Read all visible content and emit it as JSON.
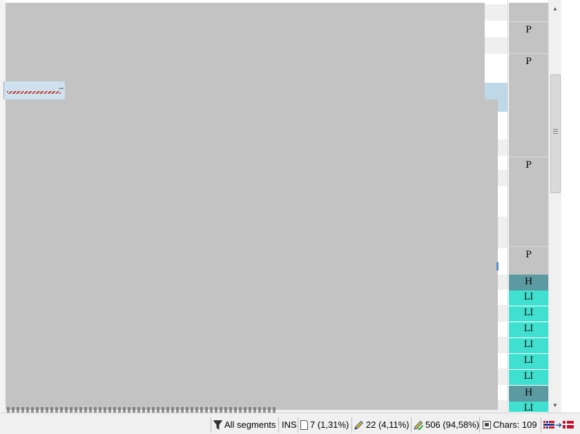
{
  "editor": {
    "style_tags": [
      "P",
      "P",
      "P",
      "P",
      "H",
      "LI",
      "LI",
      "LI",
      "LI",
      "LI",
      "LI",
      "H",
      "LI"
    ],
    "colors": {
      "tag_paragraph": "#c3c3c3",
      "tag_heading": "#5b9aa0",
      "tag_list_item": "#40e0d0",
      "selected_row": "#bfd8e8",
      "redacted": "#c3c3c3"
    }
  },
  "statusbar": {
    "filter_label": "All segments",
    "insert_mode": "INS",
    "untranslated": "7 (1,31%)",
    "draft": "22 (4,11%)",
    "translated": "506 (94,58%)",
    "chars": "Chars: 109",
    "icons": {
      "filter": "funnel-icon",
      "untranslated": "document-icon",
      "draft": "pencil-icon",
      "translated": "pencil-check-icon",
      "chars": "character-count-icon",
      "language_pair": "norway-to-denmark-flags"
    }
  }
}
